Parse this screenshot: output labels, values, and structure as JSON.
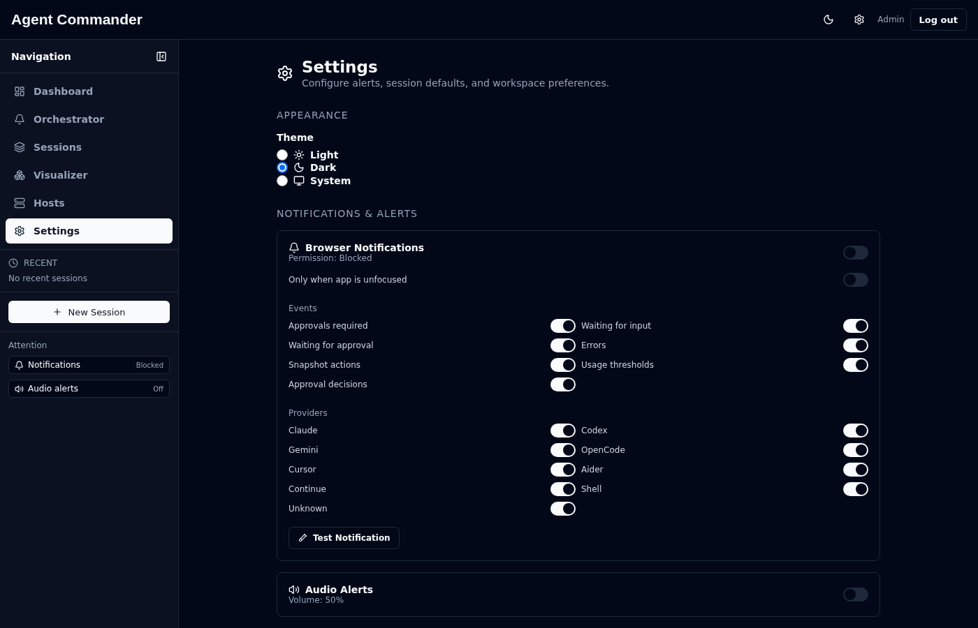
{
  "header": {
    "title": "Agent Commander",
    "user": "Admin",
    "logout": "Log out"
  },
  "sidebar": {
    "heading": "Navigation",
    "nav": [
      {
        "label": "Dashboard",
        "selected": false
      },
      {
        "label": "Orchestrator",
        "selected": false
      },
      {
        "label": "Sessions",
        "selected": false
      },
      {
        "label": "Visualizer",
        "selected": false
      },
      {
        "label": "Hosts",
        "selected": false
      },
      {
        "label": "Settings",
        "selected": true
      }
    ],
    "recent": {
      "heading": "RECENT",
      "empty": "No recent sessions"
    },
    "new_session": "New Session",
    "attention": {
      "heading": "Attention",
      "items": [
        {
          "label": "Notifications",
          "status": "Blocked"
        },
        {
          "label": "Audio alerts",
          "status": "Off"
        }
      ]
    }
  },
  "page": {
    "title": "Settings",
    "subtitle": "Configure alerts, session defaults, and workspace preferences.",
    "appearance": {
      "heading": "APPEARANCE",
      "theme_label": "Theme",
      "options": [
        {
          "label": "Light",
          "selected": false
        },
        {
          "label": "Dark",
          "selected": true
        },
        {
          "label": "System",
          "selected": false
        }
      ]
    },
    "notifications_heading": "NOTIFICATIONS & ALERTS",
    "browser_card": {
      "title": "Browser Notifications",
      "permission": "Permission: Blocked",
      "on": false,
      "unfocused": {
        "label": "Only when app is unfocused",
        "on": false
      },
      "events_heading": "Events",
      "events": [
        {
          "label": "Approvals required",
          "on": true
        },
        {
          "label": "Waiting for input",
          "on": true
        },
        {
          "label": "Waiting for approval",
          "on": true
        },
        {
          "label": "Errors",
          "on": true
        },
        {
          "label": "Snapshot actions",
          "on": true
        },
        {
          "label": "Usage thresholds",
          "on": true
        },
        {
          "label": "Approval decisions",
          "on": true
        }
      ],
      "providers_heading": "Providers",
      "providers": [
        {
          "label": "Claude",
          "on": true
        },
        {
          "label": "Codex",
          "on": true
        },
        {
          "label": "Gemini",
          "on": true
        },
        {
          "label": "OpenCode",
          "on": true
        },
        {
          "label": "Cursor",
          "on": true
        },
        {
          "label": "Aider",
          "on": true
        },
        {
          "label": "Continue",
          "on": true
        },
        {
          "label": "Shell",
          "on": true
        },
        {
          "label": "Unknown",
          "on": true
        }
      ],
      "test_button": "Test Notification"
    },
    "audio_card": {
      "title": "Audio Alerts",
      "volume": "Volume: 50%",
      "on": false
    }
  }
}
